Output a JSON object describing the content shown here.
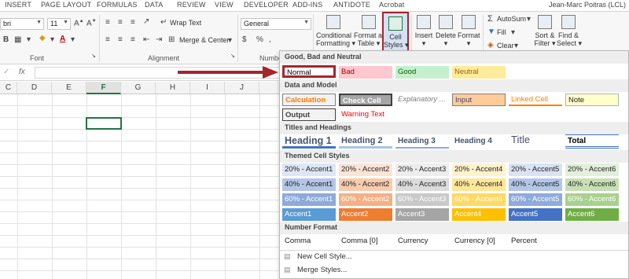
{
  "tabs": [
    "INSERT",
    "PAGE LAYOUT",
    "FORMULAS",
    "DATA",
    "REVIEW",
    "VIEW",
    "DEVELOPER",
    "ADD-INS",
    "ANTIDOTE",
    "Acrobat"
  ],
  "user_name": "Jean-Marc Poitras (LCL)",
  "ribbon": {
    "font_name": "bri",
    "font_size": "11",
    "font_group_label": "Font",
    "alignment_group_label": "Alignment",
    "number_group_label": "Numbe",
    "wrap_text": "Wrap Text",
    "merge_center": "Merge & Center",
    "number_format": "General",
    "conditional_formatting": [
      "Conditional",
      "Formatting"
    ],
    "format_as_table": [
      "Format as",
      "Table"
    ],
    "cell_styles": [
      "Cell",
      "Styles"
    ],
    "insert": "Insert",
    "delete": "Delete",
    "format": "Format",
    "autosum": "AutoSum",
    "fill": "Fill",
    "clear": "Clear",
    "sort_filter": [
      "Sort &",
      "Filter"
    ],
    "find_select": [
      "Find &",
      "Select"
    ]
  },
  "formula_bar": {
    "fx": "fx"
  },
  "grid": {
    "columns": [
      "C",
      "D",
      "E",
      "F",
      "G",
      "H",
      "I",
      "J"
    ],
    "active_column": "F"
  },
  "gallery": {
    "sections": {
      "good_bad": "Good, Bad and Neutral",
      "data_model": "Data and Model",
      "titles": "Titles and Headings",
      "themed": "Themed Cell Styles",
      "number": "Number Format"
    },
    "good_bad_styles": [
      "Normal",
      "Bad",
      "Good",
      "Neutral"
    ],
    "data_model_row1": [
      "Calculation",
      "Check Cell",
      "Explanatory ...",
      "Input",
      "Linked Cell",
      "Note"
    ],
    "data_model_row2": [
      "Output",
      "Warning Text"
    ],
    "titles_styles": [
      "Heading 1",
      "Heading 2",
      "Heading 3",
      "Heading 4",
      "Title",
      "Total"
    ],
    "themed_rows": [
      [
        "20% - Accent1",
        "20% - Accent2",
        "20% - Accent3",
        "20% - Accent4",
        "20% - Accent5",
        "20% - Accent6"
      ],
      [
        "40% - Accent1",
        "40% - Accent2",
        "40% - Accent3",
        "40% - Accent4",
        "40% - Accent5",
        "40% - Accent6"
      ],
      [
        "60% - Accent1",
        "60% - Accent2",
        "60% - Accent3",
        "60% - Accent4",
        "60% - Accent5",
        "60% - Accent6"
      ],
      [
        "Accent1",
        "Accent2",
        "Accent3",
        "Accent4",
        "Accent5",
        "Accent6"
      ]
    ],
    "number_styles": [
      "Comma",
      "Comma [0]",
      "Currency",
      "Currency [0]",
      "Percent"
    ],
    "menu": [
      "New Cell Style...",
      "Merge Styles..."
    ]
  },
  "colors": {
    "excel_green": "#217346",
    "highlight_red": "#a4262c",
    "bad_fill": "#ffc7ce",
    "good_fill": "#c6efce",
    "neutral_fill": "#ffeb9c"
  }
}
